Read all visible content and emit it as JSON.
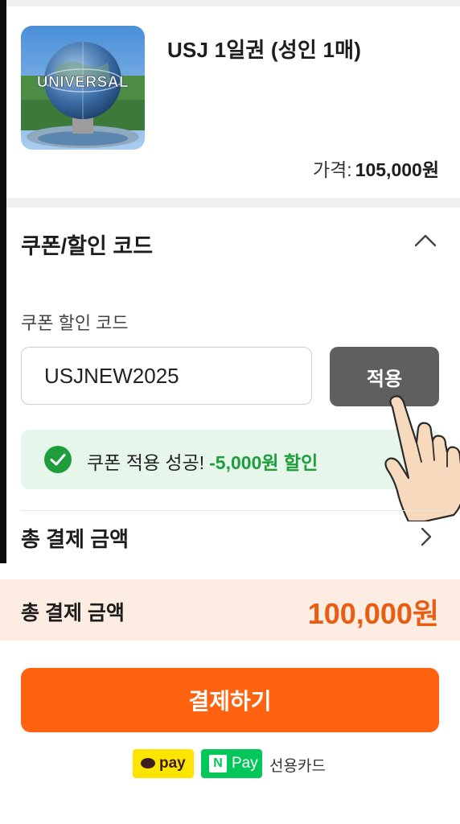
{
  "product": {
    "title": "USJ 1일권 (성인 1매)",
    "image_text": "UNIVERSAL",
    "price_label": "가격:",
    "price_value": "105,000원"
  },
  "coupon": {
    "section_title": "쿠폰/할인 코드",
    "input_label": "쿠폰 할인 코드",
    "input_value": "USJNEW2025",
    "apply_label": "적용",
    "success_text": "쿠폰 적용 성공!",
    "discount_text": "-5,000원 할인",
    "total_row_label": "총 결제 금액"
  },
  "summary": {
    "total_label": "총 결제 금액",
    "total_value": "100,000원"
  },
  "checkout": {
    "pay_button_label": "결제하기"
  },
  "payment_methods": {
    "kakao_label": "pay",
    "naver_icon_letter": "N",
    "naver_label": "Pay",
    "card_label": "선용카드"
  },
  "colors": {
    "accent_orange": "#ff6310",
    "total_orange": "#e85d12",
    "success_green": "#1e9d3c",
    "apply_gray": "#5f5f5f"
  }
}
